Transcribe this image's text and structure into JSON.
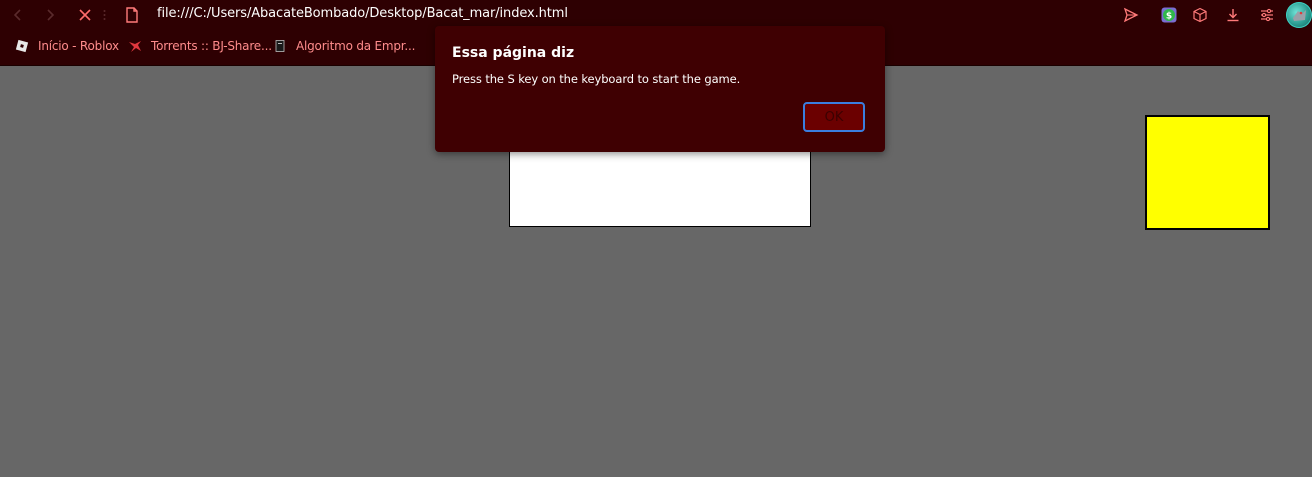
{
  "browser": {
    "address": "file:///C:/Users/AbacateBombado/Desktop/Bacat_mar/index.html",
    "bookmarks": [
      {
        "label": "Início - Roblox",
        "icon": "roblox-icon"
      },
      {
        "label": "Torrents :: BJ-Share...",
        "icon": "bjshare-icon"
      },
      {
        "label": "Algoritmo da Empr...",
        "icon": "page-icon"
      }
    ],
    "colors": {
      "chrome": "#2e0002",
      "bookmark_text": "#ff8c8c",
      "page_background": "#676767"
    }
  },
  "dialog": {
    "title": "Essa página diz",
    "message": "Press the S key on the keyboard to start the game.",
    "ok_label": "OK",
    "colors": {
      "background": "#3f0002",
      "button": "#6b0000",
      "focus_ring": "#3a7ee0"
    }
  },
  "game": {
    "colors": {
      "white_box": "#ffffff",
      "yellow_box": "#ffff00"
    }
  }
}
